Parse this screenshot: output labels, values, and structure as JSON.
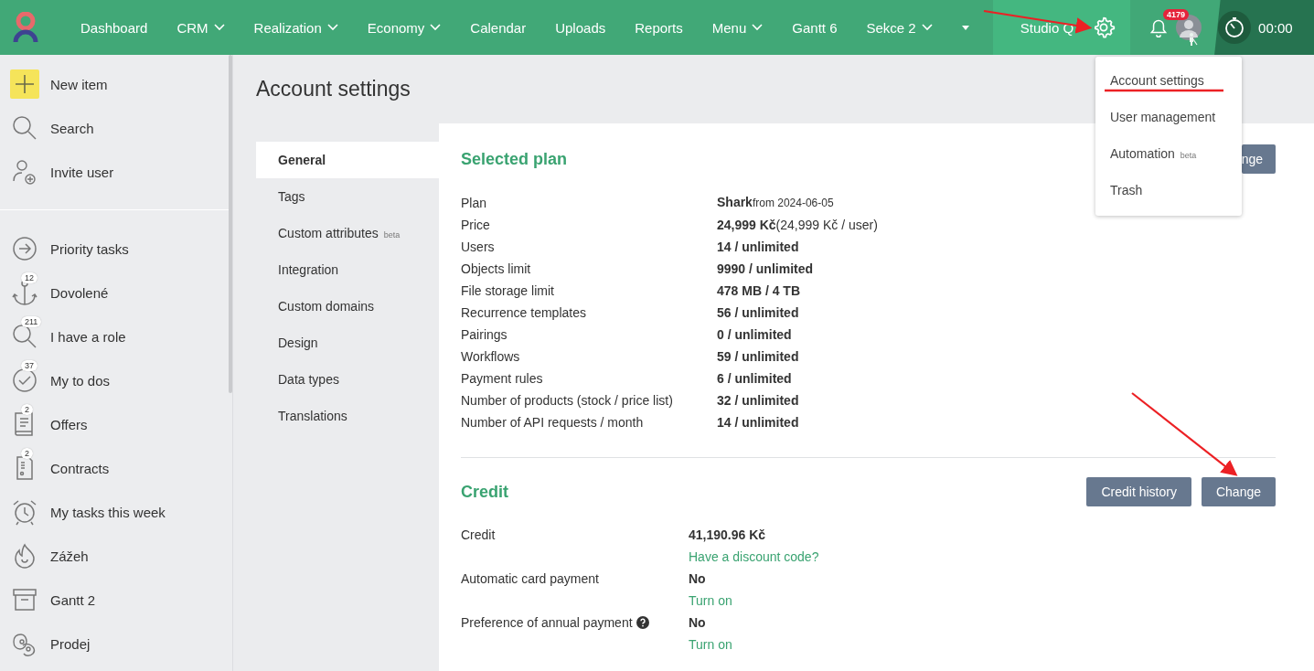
{
  "nav": {
    "items": [
      {
        "label": "Dashboard",
        "has_menu": false
      },
      {
        "label": "CRM",
        "has_menu": true
      },
      {
        "label": "Realization",
        "has_menu": true
      },
      {
        "label": "Economy",
        "has_menu": true
      },
      {
        "label": "Calendar",
        "has_menu": false
      },
      {
        "label": "Uploads",
        "has_menu": false
      },
      {
        "label": "Reports",
        "has_menu": false
      },
      {
        "label": "Menu",
        "has_menu": true
      },
      {
        "label": "Gantt 6",
        "has_menu": false
      },
      {
        "label": "Sekce 2",
        "has_menu": true
      }
    ],
    "workspace": "Studio Q",
    "notifications": "4179",
    "timer": "00:00"
  },
  "sidebar": {
    "top_items": [
      {
        "label": "New item"
      },
      {
        "label": "Search"
      },
      {
        "label": "Invite user"
      }
    ],
    "items": [
      {
        "label": "Priority tasks"
      },
      {
        "label": "Dovolené",
        "badge": "12"
      },
      {
        "label": "I have a role",
        "badge": "211"
      },
      {
        "label": "My to dos",
        "badge": "37"
      },
      {
        "label": "Offers",
        "badge": "2"
      },
      {
        "label": "Contracts",
        "badge": "2"
      },
      {
        "label": "My tasks this week"
      },
      {
        "label": "Zážeh"
      },
      {
        "label": "Gantt 2"
      },
      {
        "label": "Prodej"
      }
    ]
  },
  "page_title": "Account settings",
  "settings_tabs": [
    {
      "label": "General",
      "selected": true
    },
    {
      "label": "Tags",
      "selected": false
    },
    {
      "label": "Custom attributes",
      "badge": "beta",
      "selected": false
    },
    {
      "label": "Integration",
      "selected": false
    },
    {
      "label": "Custom domains",
      "selected": false
    },
    {
      "label": "Design",
      "selected": false
    },
    {
      "label": "Data types",
      "selected": false
    },
    {
      "label": "Translations",
      "selected": false
    }
  ],
  "plan": {
    "title": "Selected plan",
    "button": "nge",
    "rows": [
      {
        "label": "Plan",
        "value": "Shark",
        "note": "from 2024-06-05"
      },
      {
        "label": "Price",
        "value": "24,999 Kč",
        "note": "(24,999 Kč / user)"
      },
      {
        "label": "Users",
        "value": "14 / unlimited"
      },
      {
        "label": "Objects limit",
        "value": "9990 / unlimited"
      },
      {
        "label": "File storage limit",
        "value": "478 MB / 4 TB"
      },
      {
        "label": "Recurrence templates",
        "value": "56 / unlimited"
      },
      {
        "label": "Pairings",
        "value": "0 / unlimited"
      },
      {
        "label": "Workflows",
        "value": "59 / unlimited"
      },
      {
        "label": "Payment rules",
        "value": "6 / unlimited"
      },
      {
        "label": "Number of products (stock / price list)",
        "value": "32 / unlimited"
      },
      {
        "label": "Number of API requests / month",
        "value": "14 / unlimited"
      }
    ]
  },
  "credit": {
    "title": "Credit",
    "buttons": [
      "Credit history",
      "Change"
    ],
    "rows": [
      {
        "label": "Credit",
        "value": "41,190.96 Kč",
        "link": "Have a discount code?",
        "help": false
      },
      {
        "label": "Automatic card payment",
        "value": "No",
        "link": "Turn on",
        "help": false
      },
      {
        "label": "Preference of annual payment",
        "value": "No",
        "link": "Turn on",
        "help": true
      }
    ]
  },
  "dropdown": {
    "items": [
      {
        "label": "Account settings"
      },
      {
        "label": "User management"
      },
      {
        "label": "Automation",
        "badge": "beta"
      },
      {
        "label": "Trash"
      }
    ]
  }
}
